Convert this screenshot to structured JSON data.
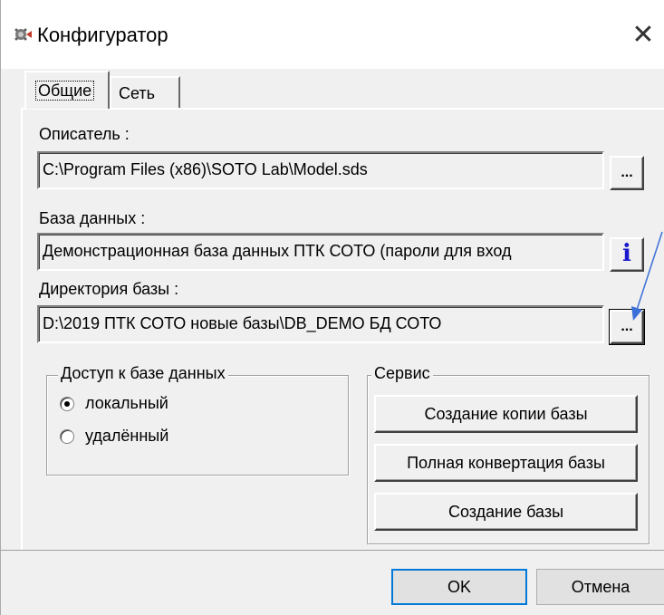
{
  "window": {
    "title": "Конфигуратор",
    "close_glyph": "✕"
  },
  "tabs": [
    {
      "label": "Общие",
      "active": true
    },
    {
      "label": "Сеть",
      "active": false
    }
  ],
  "describer": {
    "label": "Описатель :",
    "value": "C:\\Program Files (x86)\\SOTO Lab\\Model.sds",
    "browse_label": "..."
  },
  "database": {
    "label": "База данных :",
    "value": "Демонстрационная база данных ПТК СОТО (пароли для вход",
    "info_label": "i"
  },
  "db_dir": {
    "label": "Директория базы :",
    "value": "D:\\2019 ПТК СОТО новые базы\\DB_DEMO БД СОТО",
    "browse_label": "..."
  },
  "access": {
    "title": "Доступ к базе данных",
    "options": [
      {
        "label": "локальный",
        "selected": true
      },
      {
        "label": "удалённый",
        "selected": false
      }
    ]
  },
  "service": {
    "title": "Сервис",
    "buttons": [
      "Создание копии базы",
      "Полная конвертация базы",
      "Создание базы"
    ]
  },
  "footer": {
    "ok_label": "OK",
    "cancel_label": "Отмена"
  },
  "colors": {
    "arrow": "#3a6fd8",
    "focus_border": "#0078d7",
    "info_icon": "#1a1acc"
  }
}
